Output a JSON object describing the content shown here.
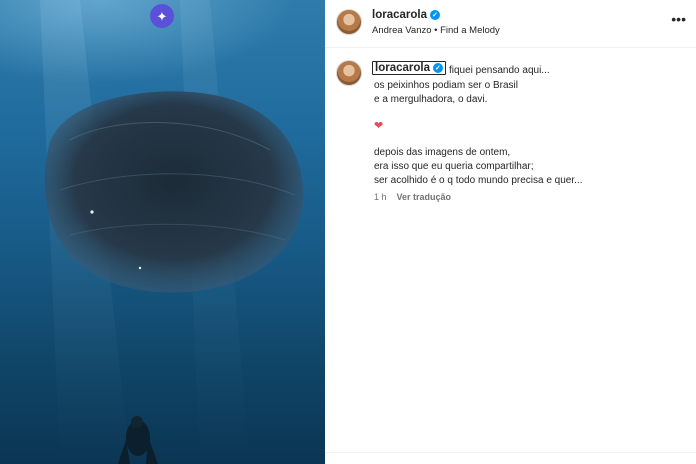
{
  "post": {
    "username": "loracarola",
    "audio": "Andrea Vanzo • Find a Melody",
    "caption_lines": [
      "fiquei pensando aqui...",
      "os peixinhos podiam ser o Brasil",
      "e a mergulhadora, o davi.",
      "depois das imagens de ontem,",
      "era isso que eu queria compartilhar;",
      "ser acolhido é o q todo mundo precisa e quer..."
    ],
    "heart_emoji": "❤",
    "time": "1 h",
    "translate_label": "Ver tradução"
  },
  "icons": {
    "ai_badge": "sparkles-icon",
    "verified": "verified-badge-icon",
    "more": "more-options-icon"
  },
  "colors": {
    "verified_blue": "#0095f6",
    "ai_badge_purple": "#5b51d8",
    "heart_red": "#ed4956",
    "ocean_top": "#2f7cab",
    "ocean_bottom": "#0b3553"
  }
}
